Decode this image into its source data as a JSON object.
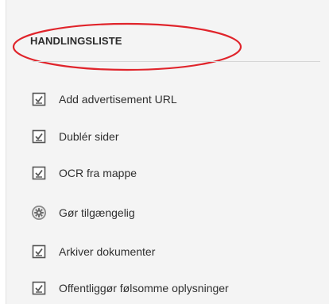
{
  "panel": {
    "title": "HANDLINGSLISTE",
    "items": [
      {
        "label": "Add advertisement URL",
        "icon": "checklist-icon"
      },
      {
        "label": "Dublér sider",
        "icon": "checklist-icon"
      },
      {
        "label": "OCR fra mappe",
        "icon": "checklist-icon"
      },
      {
        "label": "Gør tilgængelig",
        "icon": "gear-icon"
      },
      {
        "label": "Arkiver dokumenter",
        "icon": "checklist-icon"
      },
      {
        "label": "Offentliggør følsomme oplysninger",
        "icon": "checklist-icon"
      }
    ]
  },
  "colors": {
    "annotation": "#e0242b",
    "icon": "#555555",
    "background": "#f4f4f4"
  }
}
